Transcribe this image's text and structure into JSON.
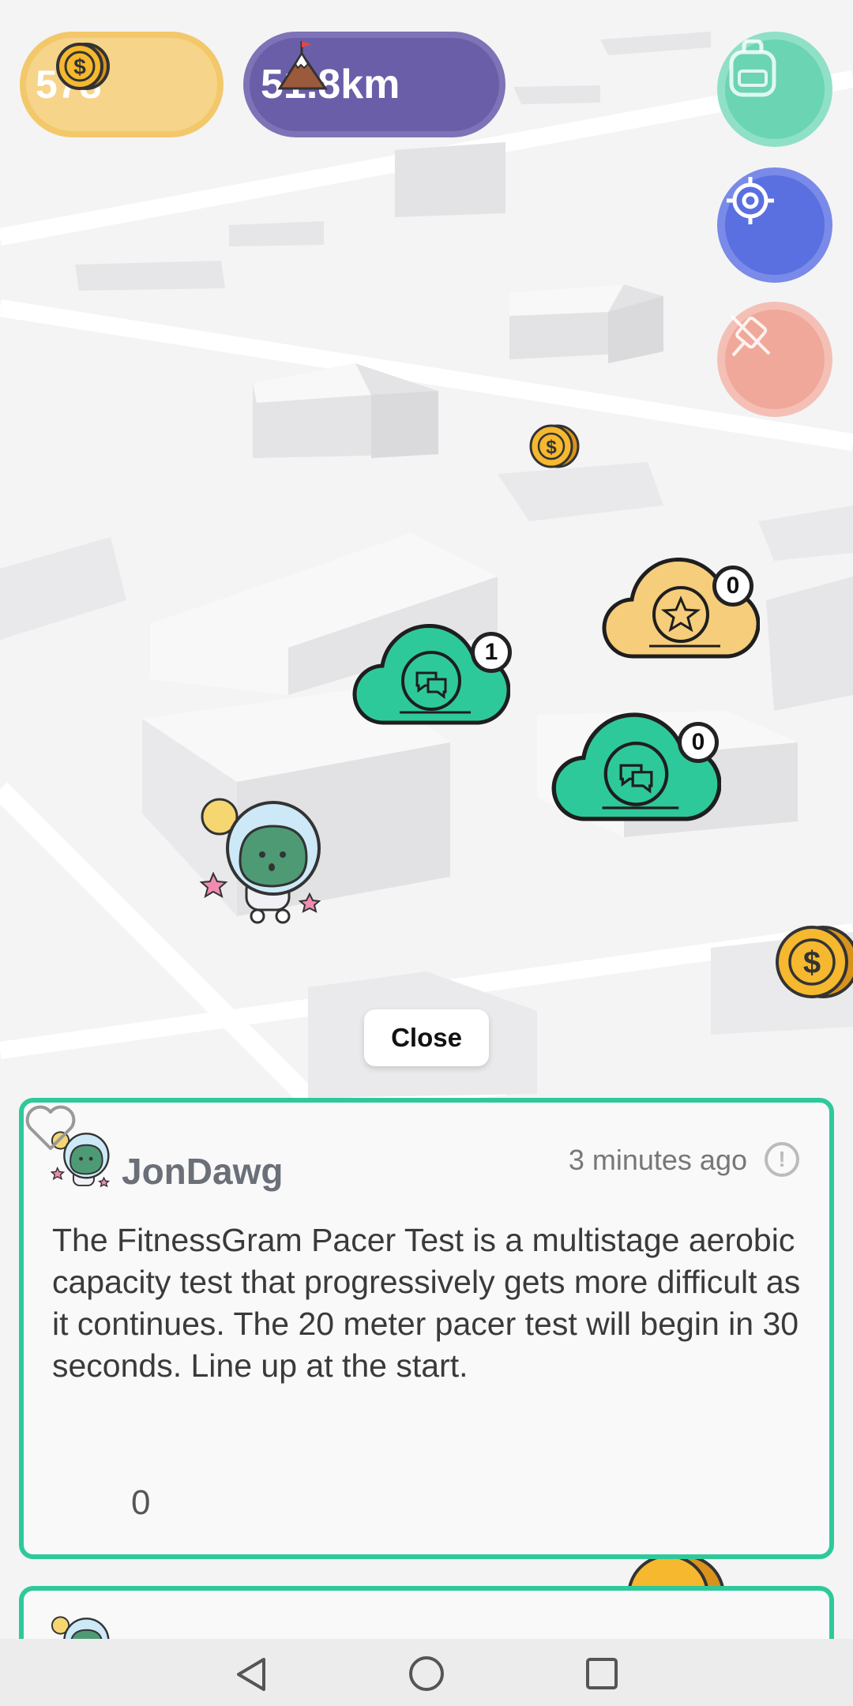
{
  "hud": {
    "coins": "578",
    "distance": "51.8km"
  },
  "markers": [
    {
      "type": "chat",
      "count": "1",
      "color": "#2ec99a"
    },
    {
      "type": "star",
      "count": "0",
      "color": "#f6cd7a"
    },
    {
      "type": "chat",
      "count": "0",
      "color": "#2ec99a"
    }
  ],
  "close_label": "Close",
  "post": {
    "username": "JonDawg",
    "time": "3 minutes ago",
    "text": "The FitnessGram Pacer Test is a multistage aerobic capacity test that progressively gets more difficult as it continues. The 20 meter pacer test will begin in 30 seconds. Line up at the start.",
    "likes": "0"
  },
  "colors": {
    "accent": "#2ec99a",
    "coin": "#f5b82e",
    "distance_pill": "#6a5ea8",
    "locate": "#5a6fe0"
  },
  "icons": [
    "coin-icon",
    "mountain-flag-icon",
    "backpack-icon",
    "crosshair-icon",
    "pin-off-icon",
    "heart-icon",
    "report-icon"
  ]
}
